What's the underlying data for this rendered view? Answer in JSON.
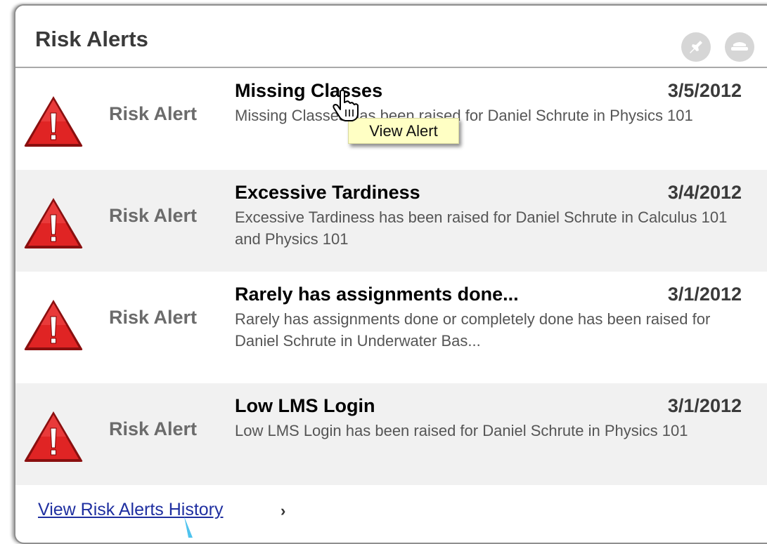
{
  "header": {
    "title": "Risk Alerts",
    "pin_icon": "pin-icon",
    "minimize_icon": "minimize-icon"
  },
  "alerts": [
    {
      "kind": "Risk Alert",
      "title": "Missing Classes",
      "date": "3/5/2012",
      "description": "Missing Classes has been raised for Daniel Schrute in Physics 101"
    },
    {
      "kind": "Risk Alert",
      "title": "Excessive Tardiness",
      "date": "3/4/2012",
      "description": "Excessive Tardiness has been raised for Daniel Schrute in Calculus 101 and Physics 101"
    },
    {
      "kind": "Risk Alert",
      "title": "Rarely has assignments done...",
      "date": "3/1/2012",
      "description": "Rarely has assignments done or completely done has been raised for Daniel Schrute in Underwater Bas..."
    },
    {
      "kind": "Risk Alert",
      "title": "Low LMS Login",
      "date": "3/1/2012",
      "description": "Low LMS Login has been raised for Daniel Schrute in Physics 101"
    }
  ],
  "tooltip": {
    "text": "View Alert"
  },
  "footer": {
    "history_link": "View Risk Alerts History",
    "chevron": "›"
  },
  "colors": {
    "warning_red": "#d71f1f",
    "link_blue": "#1f2fa0",
    "row_shade": "#f1f1f1",
    "tooltip_bg": "#ffffc4"
  }
}
